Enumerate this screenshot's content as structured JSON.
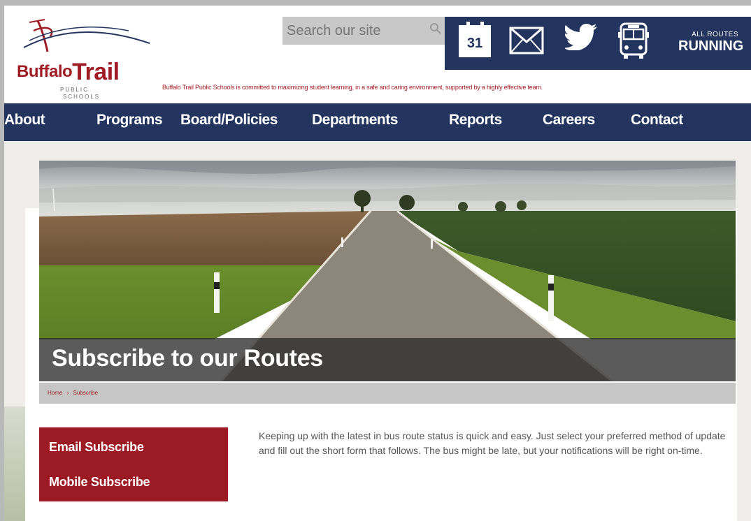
{
  "header": {
    "logo": {
      "word1": "Buffalo",
      "word2": "Trail",
      "sub1": "PUBLIC",
      "sub2": "SCHOOLS"
    },
    "search": {
      "placeholder": "Search our site"
    },
    "icons": {
      "calendar_day": "31",
      "routes_small": "ALL ROUTES",
      "routes_big": "RUNNING"
    },
    "tagline": "Buffalo Trail Public Schools is committed to maximizing student learning, in a safe and caring environment, supported by a highly effective team."
  },
  "nav": {
    "items": [
      "About",
      "Programs",
      "Board/Policies",
      "Departments",
      "Reports",
      "Careers",
      "Contact"
    ]
  },
  "hero": {
    "title": "Subscribe to our Routes"
  },
  "breadcrumb": {
    "home": "Home",
    "separator": "›",
    "current": "Subscribe"
  },
  "sidemenu": {
    "items": [
      "Email Subscribe",
      "Mobile Subscribe"
    ]
  },
  "main": {
    "text": "Keeping up with the latest in bus route status is quick and easy. Just select your preferred method of update and fill out the short form that follows. The bus might be late, but your notifications will be right on-time."
  },
  "colors": {
    "navy": "#23355e",
    "crimson": "#9c1a24"
  }
}
